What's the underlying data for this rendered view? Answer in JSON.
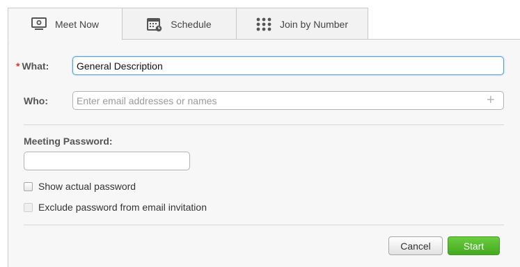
{
  "tabs": [
    {
      "label": "Meet Now",
      "icon": "monitor-icon",
      "active": true
    },
    {
      "label": "Schedule",
      "icon": "calendar-icon",
      "active": false
    },
    {
      "label": "Join by Number",
      "icon": "keypad-icon",
      "active": false
    }
  ],
  "form": {
    "what": {
      "required_marker": "*",
      "label": "What:",
      "value": "General Description"
    },
    "who": {
      "label": "Who:",
      "placeholder": "Enter email addresses or names",
      "value": "",
      "add_symbol": "+"
    },
    "password": {
      "label": "Meeting Password:",
      "value": ""
    },
    "show_password": {
      "label": "Show actual password",
      "checked": false
    },
    "exclude_password": {
      "label": "Exclude password from email invitation",
      "checked": false,
      "disabled": true
    }
  },
  "buttons": {
    "cancel": "Cancel",
    "start": "Start"
  },
  "colors": {
    "accent_focus": "#53a0d8",
    "start_green": "#4bb127",
    "required_red": "#d9342b"
  }
}
